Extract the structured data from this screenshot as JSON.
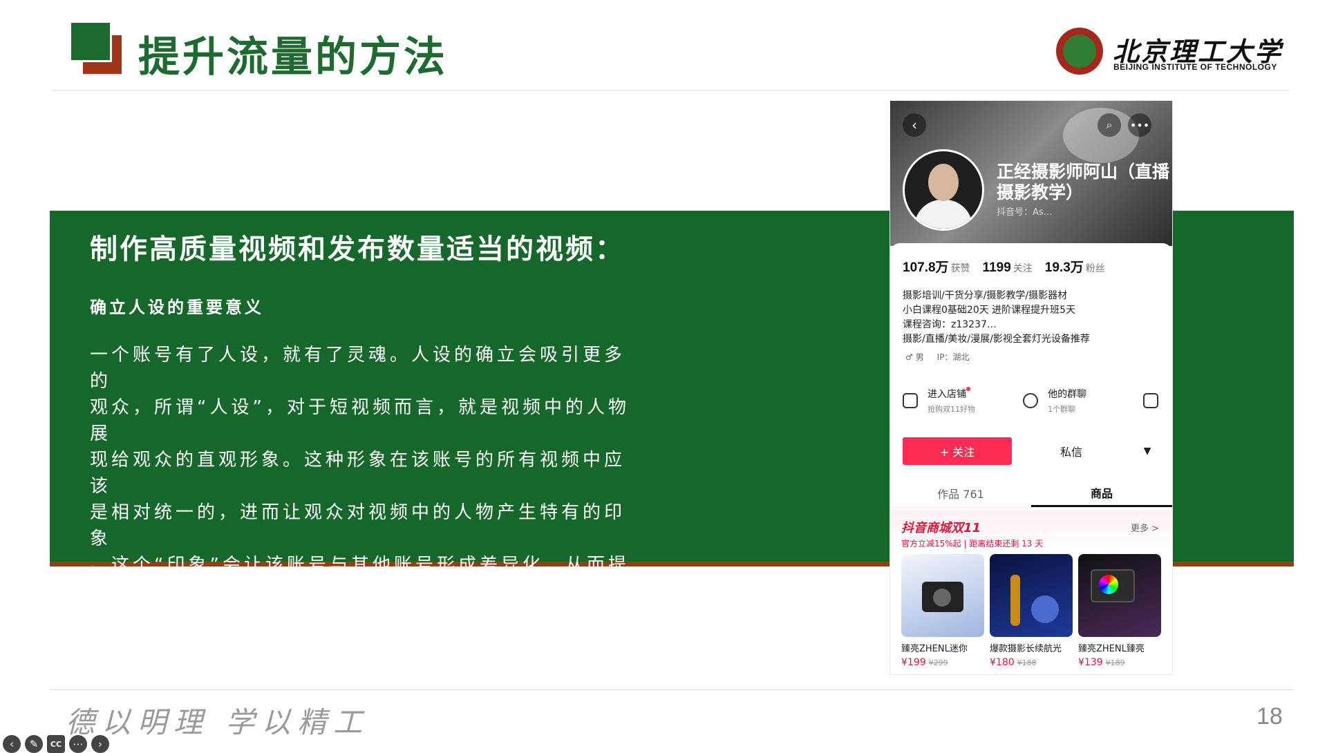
{
  "slide": {
    "title": "提升流量的方法",
    "university": {
      "name_cn": "北京理工大学",
      "name_en": "BEIJING INSTITUTE OF TECHNOLOGY"
    },
    "heading": "制作高质量视频和发布数量适当的视频：",
    "subheading": "确立人设的重要意义",
    "paragraph": "一个账号有了人设，就有了灵魂。人设的确立会吸引更多的\n观众，所谓“人设”，对于短视频而言，就是视频中的人物展\n现给观众的直观形象。这种形象在该账号的所有视频中应该\n是相对统一的，进而让观众对视频中的人物产生特有的印象\n。这个“印象”会让该账号与其他账号形成差异化，从而提高\n粉丝黏性。",
    "motto": "德以明理  学以精工",
    "page_number": "18",
    "colors": {
      "primary_green": "#15672a",
      "accent_red": "#9c3a14"
    }
  },
  "player_toolbar": {
    "icons": [
      "arrow-left-icon",
      "pen-icon",
      "cc-icon",
      "more-icon",
      "arrow-right-icon"
    ],
    "cc_label": "CC"
  },
  "profile": {
    "name": "正经摄影师阿山（直播摄影教学）",
    "douyin_id": "抖音号：As…",
    "stats": [
      {
        "num": "107.8万",
        "label": "获赞"
      },
      {
        "num": "1199",
        "label": "关注"
      },
      {
        "num": "19.3万",
        "label": "粉丝"
      }
    ],
    "bio": "摄影培训/干货分享/摄影教学/摄影器材\n小白课程0基础20天 进阶课程提升班5天\n课程咨询：z13237…\n摄影/直播/美妆/漫展/影视全套灯光设备推荐",
    "gender": "♂ 男",
    "ip": "IP：湖北",
    "actions": [
      {
        "title": "进入店铺",
        "sub": "抢购双11好物"
      },
      {
        "title": "他的群聊",
        "sub": "1个群聊"
      }
    ],
    "follow_label": "+ 关注",
    "message_label": "私信",
    "tabs": [
      {
        "label": "作品 761"
      },
      {
        "label": "商品"
      }
    ],
    "mall": {
      "title": "抖音商城双11",
      "more": "更多 >",
      "sub": "官方立减15%起 | 距离结束还剩 13 天"
    },
    "products": [
      {
        "name": "臻亮ZHENL迷你",
        "price": "¥199",
        "orig": "¥299"
      },
      {
        "name": "爆款摄影长续航光",
        "price": "¥180",
        "orig": "¥188"
      },
      {
        "name": "臻亮ZHENL臻亮",
        "price": "¥139",
        "orig": "¥189"
      }
    ]
  }
}
